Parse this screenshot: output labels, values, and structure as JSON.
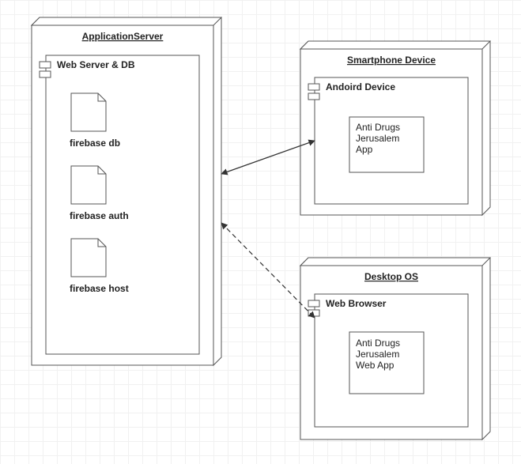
{
  "nodes": {
    "appServer": {
      "title": "ApplicationServer",
      "webServer": {
        "title": "Web Server & DB",
        "artifacts": [
          "firebase db",
          "firebase auth",
          "firebase host"
        ]
      }
    },
    "smartphone": {
      "title": "Smartphone Device",
      "android": {
        "title": "Andoird Device",
        "app": "Anti Drugs\nJerusalem\nApp"
      }
    },
    "desktop": {
      "title": "Desktop OS",
      "browser": {
        "title": "Web Browser",
        "app": "Anti Drugs\nJerusalem\nWeb App"
      }
    }
  },
  "connectors": [
    {
      "from": "appServer",
      "to": "smartphone.android",
      "style": "solid",
      "arrows": "both"
    },
    {
      "from": "appServer",
      "to": "desktop.browser",
      "style": "dashed",
      "arrows": "both"
    }
  ]
}
